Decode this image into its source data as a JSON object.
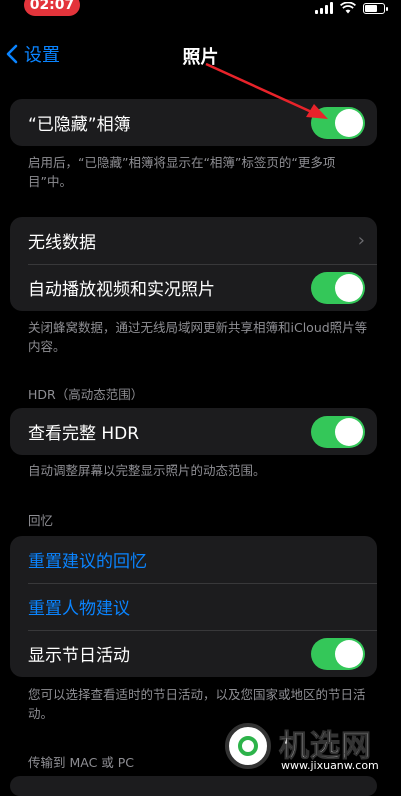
{
  "status_bar": {
    "time": "02:07"
  },
  "nav": {
    "back_label": "设置",
    "title": "照片"
  },
  "hidden_album": {
    "label": "“已隐藏”相簿",
    "enabled": true,
    "footnote": "启用后，“已隐藏”相簿将显示在“相簿”标签页的“更多项目”中。"
  },
  "mobile_data": {
    "wireless_label": "无线数据",
    "autoplay_label": "自动播放视频和实况照片",
    "autoplay_enabled": true,
    "footnote": "关闭蜂窝数据，通过无线局域网更新共享相簿和iCloud照片等内容。"
  },
  "hdr": {
    "header": "HDR（高动态范围）",
    "full_hdr_label": "查看完整 HDR",
    "full_hdr_enabled": true,
    "footnote": "自动调整屏幕以完整显示照片的动态范围。"
  },
  "memories": {
    "header": "回忆",
    "reset_suggested_label": "重置建议的回忆",
    "reset_people_label": "重置人物建议",
    "holiday_events_label": "显示节日活动",
    "holiday_events_enabled": true,
    "footnote": "您可以选择查看适时的节日活动，以及您国家或地区的节日活动。"
  },
  "transfer": {
    "header": "传输到 MAC 或 PC"
  },
  "watermark": {
    "name": "机选网",
    "url": "www.jixuanw.com"
  }
}
